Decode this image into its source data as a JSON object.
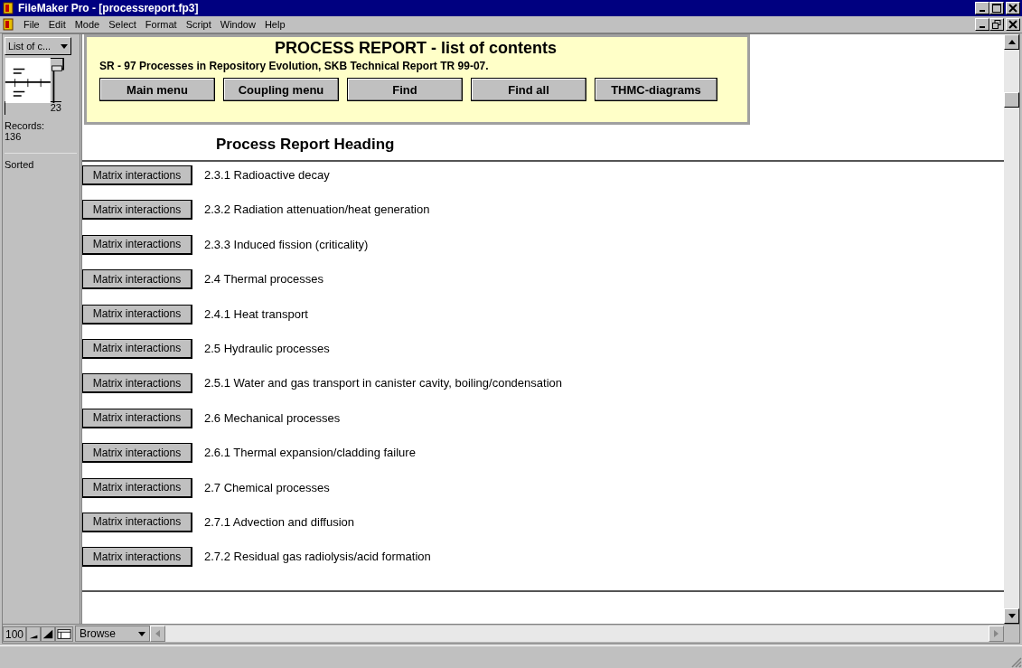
{
  "window": {
    "title": "FileMaker Pro - [processreport.fp3]"
  },
  "menu": [
    {
      "label": "File"
    },
    {
      "label": "Edit"
    },
    {
      "label": "Mode"
    },
    {
      "label": "Select"
    },
    {
      "label": "Format"
    },
    {
      "label": "Script"
    },
    {
      "label": "Window"
    },
    {
      "label": "Help"
    }
  ],
  "status_area": {
    "layout": "List of c...",
    "record_number": "23",
    "records_label": "Records:",
    "records_count": "136",
    "sort_state": "Sorted"
  },
  "header": {
    "title": "PROCESS REPORT - list of contents",
    "subtitle": "SR - 97 Processes in Repository Evolution, SKB Technical Report TR 99-07.",
    "buttons": [
      "Main menu",
      "Coupling menu",
      "Find",
      "Find all",
      "THMC-diagrams"
    ]
  },
  "column_heading": "Process Report Heading",
  "rows": [
    {
      "button": "Matrix interactions",
      "heading": "2.3.1 Radioactive decay"
    },
    {
      "button": "Matrix interactions",
      "heading": "2.3.2 Radiation attenuation/heat generation"
    },
    {
      "button": "Matrix interactions",
      "heading": "2.3.3 Induced fission (criticality)"
    },
    {
      "button": "Matrix interactions",
      "heading": "2.4 Thermal processes"
    },
    {
      "button": "Matrix interactions",
      "heading": "2.4.1 Heat transport"
    },
    {
      "button": "Matrix interactions",
      "heading": "2.5 Hydraulic processes"
    },
    {
      "button": "Matrix interactions",
      "heading": "2.5.1 Water and gas transport in canister cavity, boiling/condensation"
    },
    {
      "button": "Matrix interactions",
      "heading": "2.6 Mechanical processes"
    },
    {
      "button": "Matrix interactions",
      "heading": "2.6.1 Thermal expansion/cladding failure"
    },
    {
      "button": "Matrix interactions",
      "heading": "2.7 Chemical processes"
    },
    {
      "button": "Matrix interactions",
      "heading": "2.7.1 Advection and diffusion"
    },
    {
      "button": "Matrix interactions",
      "heading": "2.7.2 Residual gas radiolysis/acid formation"
    }
  ],
  "bottom_bar": {
    "zoom": "100",
    "mode": "Browse"
  }
}
